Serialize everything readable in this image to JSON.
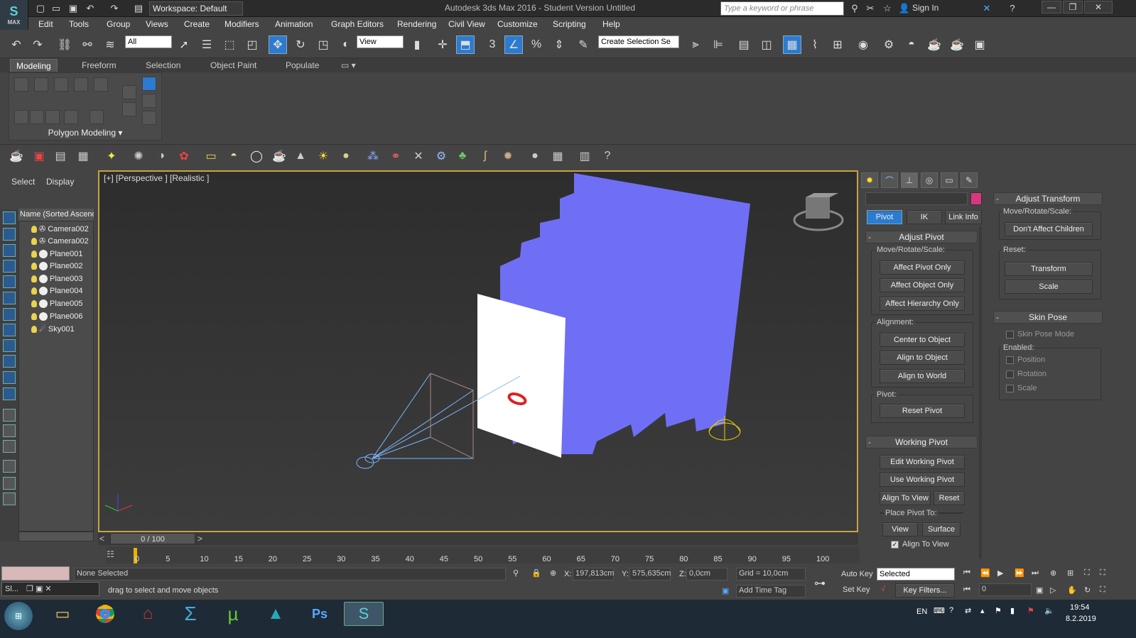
{
  "titlebar": {
    "workspace": "Workspace: Default",
    "title": "Autodesk 3ds Max 2016 - Student Version   Untitled",
    "search_placeholder": "Type a keyword or phrase",
    "signin": "Sign In",
    "logo_text": "MAX"
  },
  "menu": [
    "Edit",
    "Tools",
    "Group",
    "Views",
    "Create",
    "Modifiers",
    "Animation",
    "Graph Editors",
    "Rendering",
    "Civil View",
    "Customize",
    "Scripting",
    "Help"
  ],
  "toolbar": {
    "filter": "All",
    "refcoord": "View",
    "selection_set": "Create Selection Se"
  },
  "ribbon": {
    "tabs": [
      "Modeling",
      "Freeform",
      "Selection",
      "Object Paint",
      "Populate"
    ],
    "label": "Polygon Modeling"
  },
  "scene": {
    "tabs": [
      "Select",
      "Display"
    ],
    "column_header": "Name (Sorted Ascend",
    "items": [
      {
        "name": "Camera002",
        "icon": "camera-icon"
      },
      {
        "name": "Camera002",
        "icon": "camera-icon"
      },
      {
        "name": "Plane001",
        "icon": "plane-icon"
      },
      {
        "name": "Plane002",
        "icon": "plane-icon"
      },
      {
        "name": "Plane003",
        "icon": "plane-icon"
      },
      {
        "name": "Plane004",
        "icon": "plane-icon"
      },
      {
        "name": "Plane005",
        "icon": "plane-icon"
      },
      {
        "name": "Plane006",
        "icon": "plane-icon"
      },
      {
        "name": "Sky001",
        "icon": "sky-light-icon"
      }
    ]
  },
  "viewport": {
    "label": "[+] [Perspective ] [Realistic ]"
  },
  "timeline": {
    "slider": "0 / 100",
    "ticks": [
      "0",
      "5",
      "10",
      "15",
      "20",
      "25",
      "30",
      "35",
      "40",
      "45",
      "50",
      "55",
      "60",
      "65",
      "70",
      "75",
      "80",
      "85",
      "90",
      "95",
      "100"
    ]
  },
  "hierarchy": {
    "tabs": [
      "Pivot",
      "IK",
      "Link Info"
    ],
    "adjust_pivot": {
      "title": "Adjust Pivot",
      "move_label": "Move/Rotate/Scale:",
      "buttons": [
        "Affect Pivot Only",
        "Affect Object Only",
        "Affect Hierarchy Only"
      ],
      "alignment_label": "Alignment:",
      "align_buttons": [
        "Center to Object",
        "Align to Object",
        "Align to World"
      ],
      "pivot_label": "Pivot:",
      "reset_pivot": "Reset Pivot"
    },
    "working_pivot": {
      "title": "Working Pivot",
      "buttons": [
        "Edit Working Pivot",
        "Use Working Pivot"
      ],
      "align_to_view": "Align To View",
      "reset": "Reset",
      "place_label": "Place Pivot To:",
      "view": "View",
      "surface": "Surface",
      "align_check": "Align To View"
    },
    "adjust_transform": {
      "title": "Adjust Transform",
      "move_label": "Move/Rotate/Scale:",
      "dont_affect": "Don't Affect Children",
      "reset_label": "Reset:",
      "transform": "Transform",
      "scale": "Scale"
    },
    "skin_pose": {
      "title": "Skin Pose",
      "mode": "Skin Pose Mode",
      "enabled_label": "Enabled:",
      "position": "Position",
      "rotation": "Rotation",
      "scale": "Scale"
    }
  },
  "status": {
    "selection": "None Selected",
    "prompt": "drag to select and move objects",
    "x_label": "X:",
    "x": "197,813cm",
    "y_label": "Y:",
    "y": "575,635cm",
    "z_label": "Z:",
    "z": "0,0cm",
    "grid": "Grid = 10,0cm",
    "add_time_tag": "Add Time Tag",
    "auto_key": "Auto Key",
    "set_key": "Set Key",
    "key_mode": "Selected",
    "key_filters": "Key Filters...",
    "frame": "0",
    "script": "Sl..."
  },
  "taskbar": {
    "lang": "EN",
    "time": "19:54",
    "date": "8.2.2019"
  },
  "colors": {
    "accent": "#2c7bd0",
    "viewport_border": "#c9a341",
    "blue_plane": "#6f6ff5"
  }
}
